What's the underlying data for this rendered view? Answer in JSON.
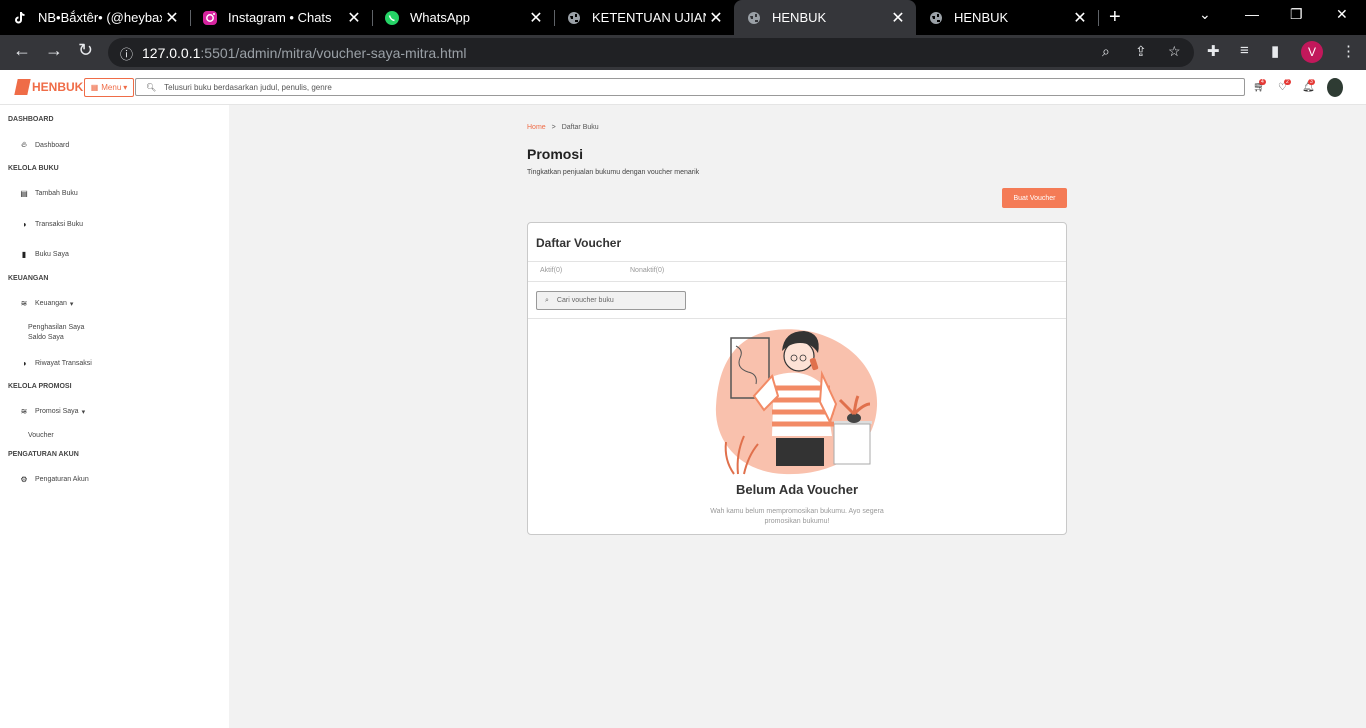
{
  "browser": {
    "tabs": [
      {
        "title": "NB•Bắxtêr• (@heybaxt",
        "icon": "tiktok-icon",
        "active": false
      },
      {
        "title": "Instagram • Chats",
        "icon": "instagram-icon",
        "active": false
      },
      {
        "title": "WhatsApp",
        "icon": "whatsapp-icon",
        "active": false
      },
      {
        "title": "KETENTUAN UJIAN PF",
        "icon": "globe-icon",
        "active": false
      },
      {
        "title": "HENBUK",
        "icon": "globe-icon",
        "active": true
      },
      {
        "title": "HENBUK",
        "icon": "globe-icon",
        "active": false
      }
    ],
    "url_host": "127.0.0.1",
    "url_rest": ":5501/admin/mitra/voucher-saya-mitra.html",
    "profile_initial": "V"
  },
  "header": {
    "logo_text": "HENBUK",
    "menu_label": "Menu",
    "search_placeholder": "Telusuri buku berdasarkan judul, penulis, genre",
    "cart_badge": "4",
    "wishlist_badge": "2",
    "notif_badge": "3"
  },
  "sidebar": {
    "dashboard_head": "DASHBOARD",
    "dashboard": "Dashboard",
    "kelola_buku_head": "KELOLA BUKU",
    "tambah_buku": "Tambah Buku",
    "transaksi_buku": "Transaksi Buku",
    "buku_saya": "Buku Saya",
    "keuangan_head": "KEUANGAN",
    "keuangan": "Keuangan",
    "penghasilan": "Penghasilan Saya",
    "saldo": "Saldo Saya",
    "riwayat": "Riwayat Transaksi",
    "promosi_head": "KELOLA PROMOSI",
    "promosi_saya": "Promosi Saya",
    "voucher": "Voucher",
    "pengaturan_head": "PENGATURAN AKUN",
    "pengaturan_akun": "Pengaturan Akun"
  },
  "main": {
    "crumb_home": "Home",
    "crumb_sep": ">",
    "crumb_current": "Daftar Buku",
    "title": "Promosi",
    "subtitle": "Tingkatkan penjualan bukumu dengan voucher menarik",
    "create_button": "Buat Voucher",
    "card_title": "Daftar Voucher",
    "tab_active": "Aktif(0)",
    "tab_inactive": "Nonaktif(0)",
    "voucher_search_placeholder": "Cari voucher buku",
    "empty_title": "Belum Ada Voucher",
    "empty_text": "Wah kamu belum mempromosikan bukumu. Ayo segera promosikan bukumu!"
  },
  "colors": {
    "accent": "#ef6c47",
    "button": "#f47b56",
    "illustration_blob": "#f9c1ad"
  }
}
